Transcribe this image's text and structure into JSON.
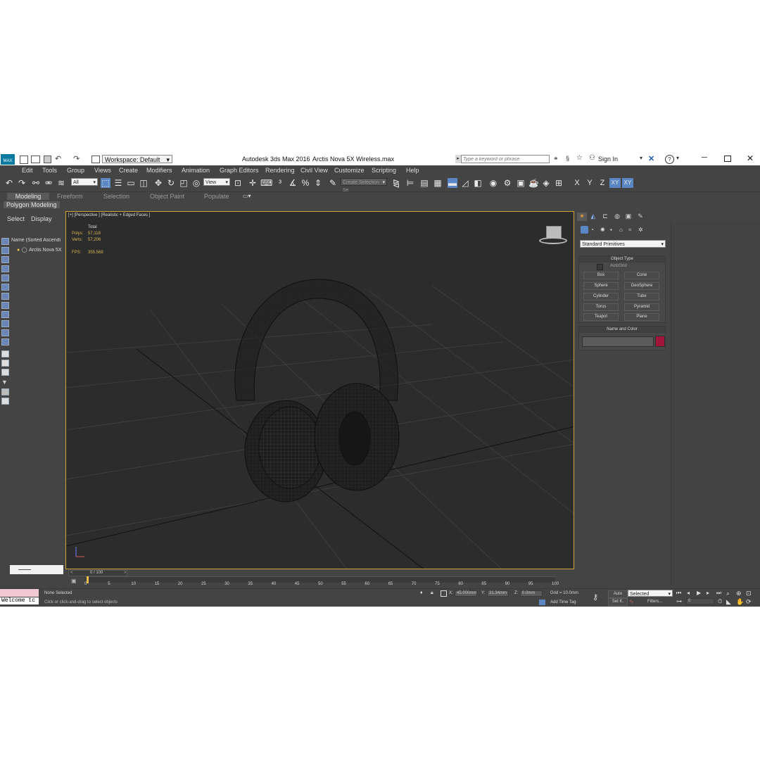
{
  "titlebar": {
    "workspace": "Workspace: Default",
    "app_title": "Autodesk 3ds Max 2016",
    "file_name": "Arctis Nova 5X Wireless.max",
    "search_placeholder": "Type a keyword or phrase",
    "sign_in": "Sign In"
  },
  "menu": [
    "Edit",
    "Tools",
    "Group",
    "Views",
    "Create",
    "Modifiers",
    "Animation",
    "Graph Editors",
    "Rendering",
    "Civil View",
    "Customize",
    "Scripting",
    "Help"
  ],
  "toolbar": {
    "filter_value": "All",
    "coord_value": "View",
    "selection_set_placeholder": "Create Selection Se",
    "axis_x": "X",
    "axis_y": "Y",
    "axis_z": "Z",
    "axis_xy": "XY",
    "axis_xy2": "XY"
  },
  "ribbon": {
    "tabs": [
      "Modeling",
      "Freeform",
      "Selection",
      "Object Paint",
      "Populate"
    ],
    "active_subtab": "Polygon Modeling"
  },
  "scene_explorer": {
    "menu_select": "Select",
    "menu_display": "Display",
    "column_header": "Name (Sorted Ascendi",
    "item": "Arctis Nova 5X"
  },
  "viewport": {
    "label": "[+] [Perspective ] [Realistic + Edged Faces ]",
    "stats_total": "Total",
    "polys_label": "Polys:",
    "polys_value": "57,118",
    "verts_label": "Verts:",
    "verts_value": "57,206",
    "fps_label": "FPS:",
    "fps_value": "355.568"
  },
  "command_panel": {
    "dropdown": "Standard Primitives",
    "object_type_title": "Object Type",
    "autogrid": "AutoGrid",
    "primitives": [
      "Box",
      "Cone",
      "Sphere",
      "GeoSphere",
      "Cylinder",
      "Tube",
      "Torus",
      "Pyramid",
      "Teapot",
      "Plane"
    ],
    "name_color_title": "Name and Color",
    "color_swatch": "#a0153a"
  },
  "timeline": {
    "frame_readout": "0 / 100",
    "ticks": [
      "0",
      "5",
      "10",
      "15",
      "20",
      "25",
      "30",
      "35",
      "40",
      "45",
      "50",
      "55",
      "60",
      "65",
      "70",
      "75",
      "80",
      "85",
      "90",
      "95",
      "100"
    ]
  },
  "statusbar": {
    "listener": "Welcome tc",
    "selection_status": "None Selected",
    "prompt": "Click or click-and-drag to select objects",
    "x_label": "X:",
    "x_value": "45.000mm",
    "y_label": "Y:",
    "y_value": "31.34mm",
    "z_label": "Z:",
    "z_value": "0.0mm",
    "grid": "Grid = 10.0mm",
    "add_time_tag": "Add Time Tag",
    "auto": "Auto",
    "set_key": "Set K.",
    "selected_value": "Selected",
    "filters": "Filters...",
    "frame_value": "0"
  },
  "colors": {
    "selection_border": "#d0a431",
    "active_blue": "#5b88c4",
    "stats_text": "#d8b451"
  }
}
